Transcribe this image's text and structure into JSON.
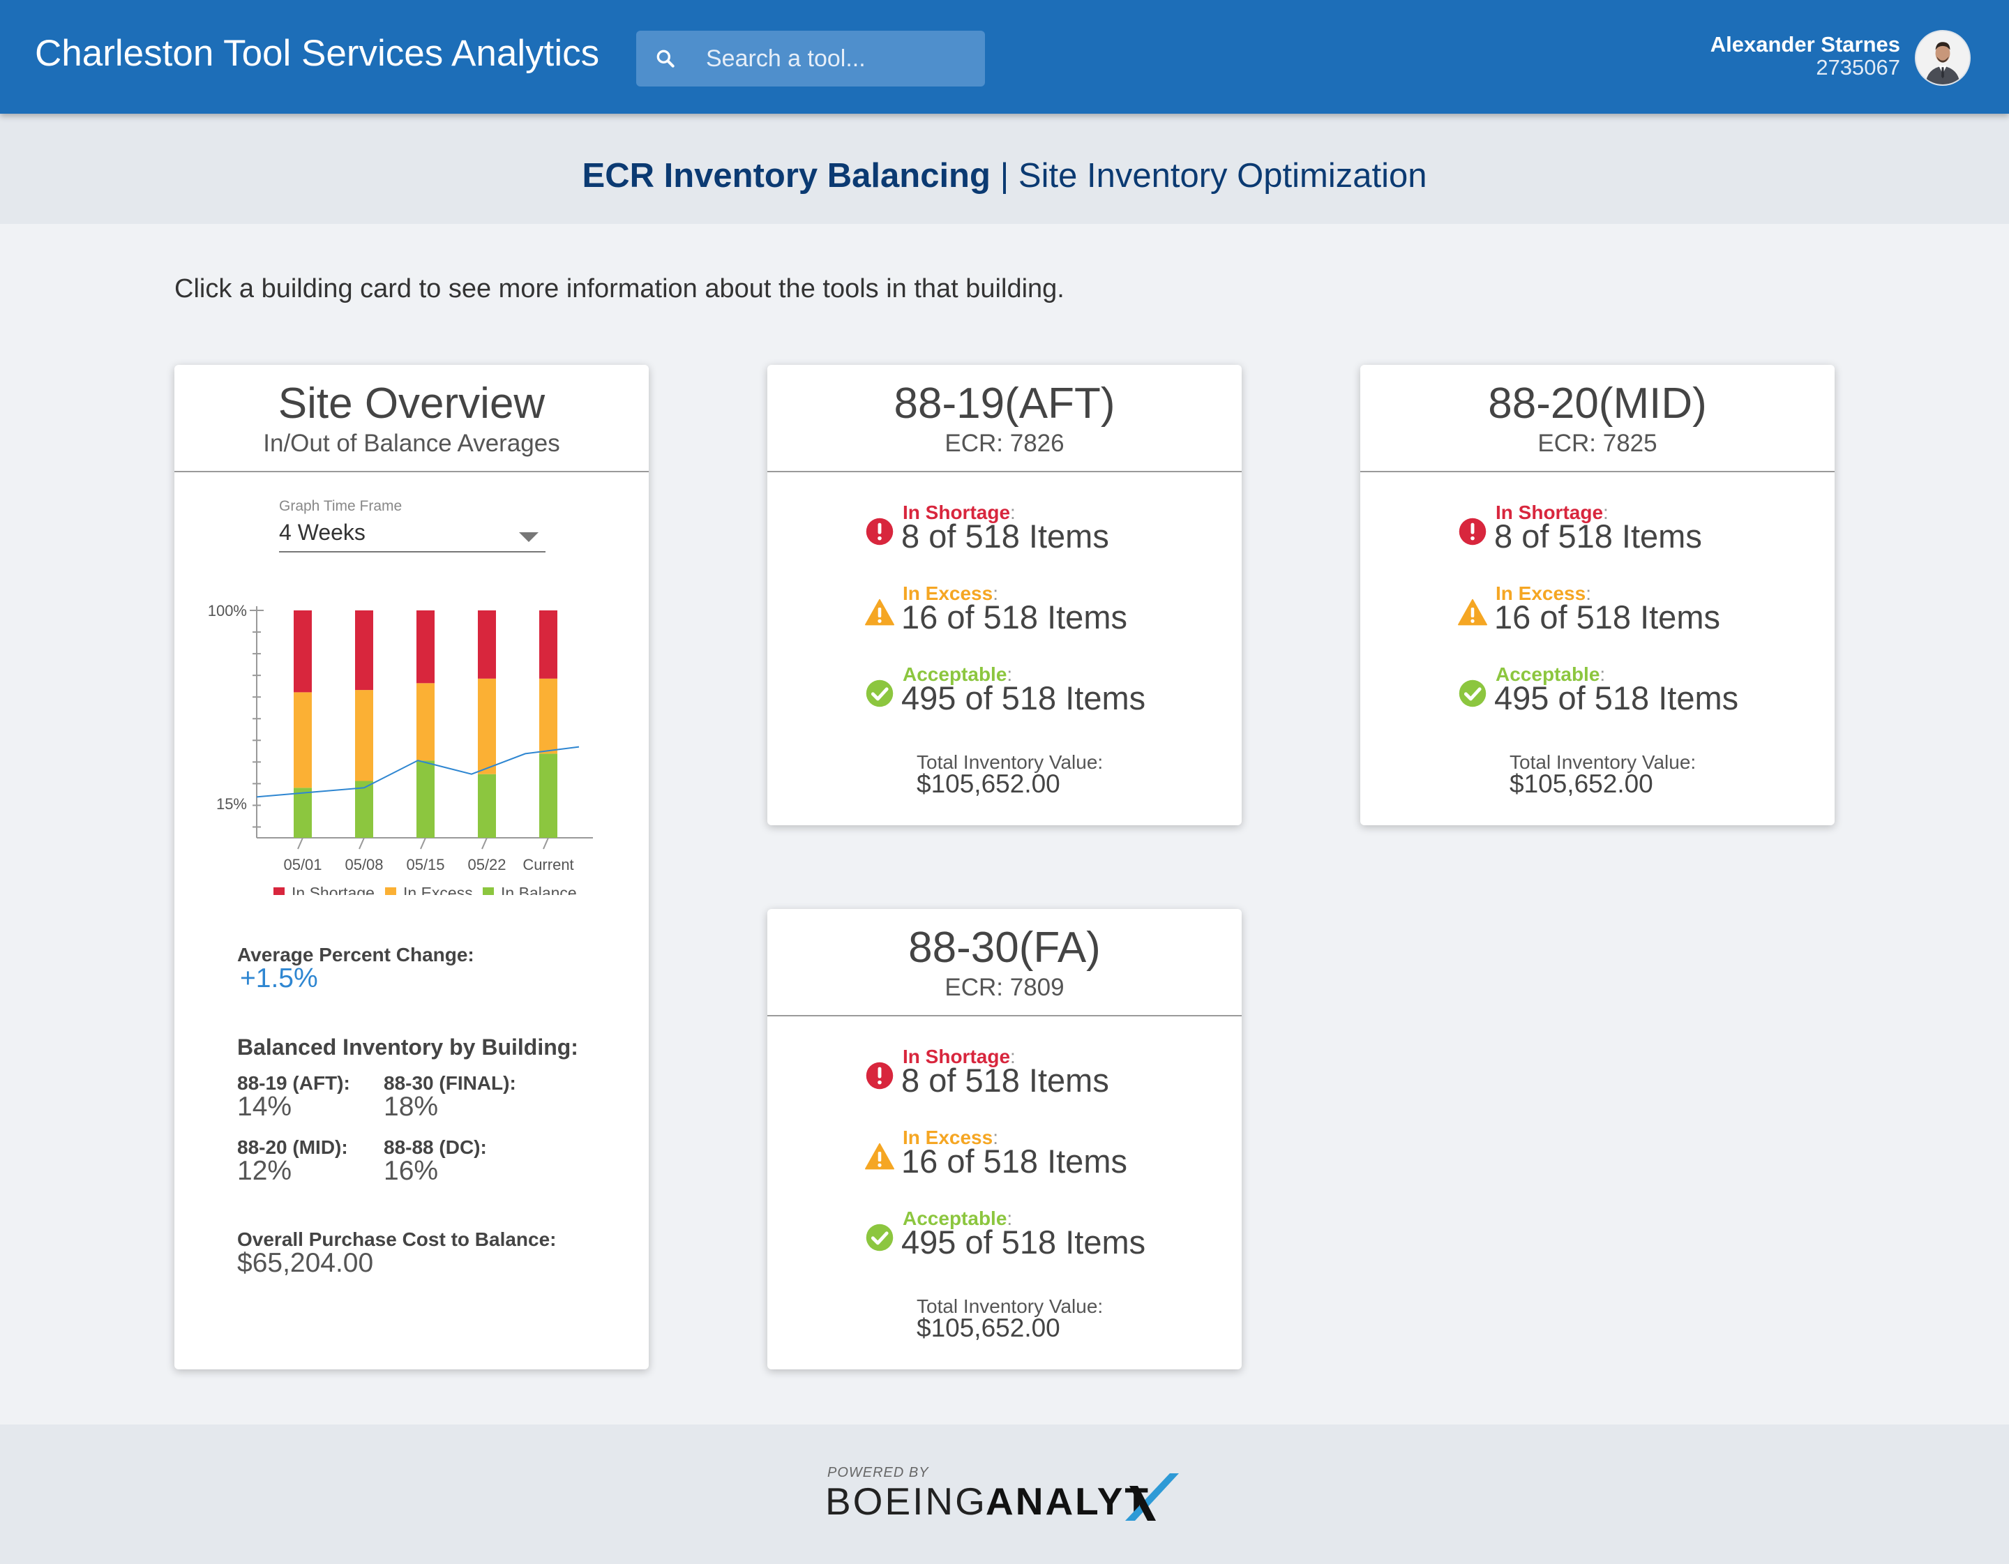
{
  "header": {
    "app_title": "Charleston Tool Services Analytics",
    "search_placeholder": "Search a tool...",
    "user_name": "Alexander Starnes",
    "user_id": "2735067",
    "brand_color": "#1d6eb8"
  },
  "subheader": {
    "title_strong": "ECR Inventory Balancing",
    "separator": "|",
    "title_light": "Site Inventory Optimization"
  },
  "instruction": "Click a building card to see more information about the tools in that building.",
  "overview": {
    "title": "Site Overview",
    "subtitle": "In/Out of Balance Averages",
    "timeframe_label": "Graph Time Frame",
    "timeframe_value": "4 Weeks",
    "avg_change_label": "Average Percent Change:",
    "avg_change_value": "+1.5%",
    "balanced_heading": "Balanced Inventory by Building:",
    "buildings": [
      {
        "label": "88-19 (AFT):",
        "value": "14%"
      },
      {
        "label": "88-30 (FINAL):",
        "value": "18%"
      },
      {
        "label": "88-20 (MID):",
        "value": "12%"
      },
      {
        "label": "88-88 (DC):",
        "value": "16%"
      }
    ],
    "purchase_label": "Overall Purchase Cost to Balance:",
    "purchase_value": "$65,204.00"
  },
  "chart_data": {
    "type": "bar",
    "stacked": true,
    "categories": [
      "05/01",
      "05/08",
      "05/15",
      "05/22",
      "Current"
    ],
    "y_tick_labels": [
      "100%",
      "15%"
    ],
    "series": [
      {
        "name": "In Balance",
        "color": "#8cc63f",
        "values": [
          22,
          25,
          34,
          28,
          37
        ]
      },
      {
        "name": "In Excess",
        "color": "#fbb034",
        "values": [
          42,
          40,
          34,
          42,
          33
        ]
      },
      {
        "name": "In Shortage",
        "color": "#d8263d",
        "values": [
          36,
          35,
          32,
          30,
          30
        ]
      }
    ],
    "trend_line": {
      "color": "#2e86d1",
      "values": [
        18,
        20,
        22,
        34,
        28,
        37,
        40
      ]
    },
    "legend": [
      "In Shortage",
      "In Excess",
      "In Balance"
    ],
    "legend_position": "bottom",
    "ylim": [
      0,
      100
    ]
  },
  "cards": [
    {
      "title": "88-19(AFT)",
      "ecr": "ECR: 7826",
      "shortage_label": "In Shortage",
      "shortage_value": "8 of 518 Items",
      "excess_label": "In Excess",
      "excess_value": "16 of 518 Items",
      "acceptable_label": "Acceptable",
      "acceptable_value": "495 of 518 Items",
      "tiv_label": "Total Inventory Value:",
      "tiv_value": "$105,652.00"
    },
    {
      "title": "88-20(MID)",
      "ecr": "ECR: 7825",
      "shortage_label": "In Shortage",
      "shortage_value": "8 of 518 Items",
      "excess_label": "In Excess",
      "excess_value": "16 of 518 Items",
      "acceptable_label": "Acceptable",
      "acceptable_value": "495 of 518 Items",
      "tiv_label": "Total Inventory Value:",
      "tiv_value": "$105,652.00"
    },
    {
      "title": "88-30(FA)",
      "ecr": "ECR: 7809",
      "shortage_label": "In Shortage",
      "shortage_value": "8 of 518 Items",
      "excess_label": "In Excess",
      "excess_value": "16 of 518 Items",
      "acceptable_label": "Acceptable",
      "acceptable_value": "495 of 518 Items",
      "tiv_label": "Total Inventory Value:",
      "tiv_value": "$105,652.00"
    }
  ],
  "colors": {
    "shortage": "#d8263d",
    "excess": "#f5a623",
    "acceptable": "#8cc63f",
    "change_value": "#2e86d1"
  },
  "footer": {
    "powered_by": "POWERED BY",
    "brand_a": "BOEING",
    "brand_b": "ANALYT",
    "brand_x": "X"
  },
  "icons": {
    "search": "search-icon",
    "shortage": "error-circle-icon",
    "excess": "warning-triangle-icon",
    "acceptable": "check-circle-icon"
  }
}
